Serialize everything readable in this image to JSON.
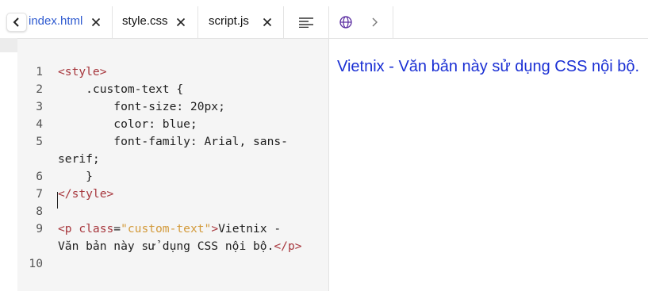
{
  "tabs": [
    {
      "label": "index.html",
      "active": true
    },
    {
      "label": "style.css"
    },
    {
      "label": "script.js"
    }
  ],
  "icons": {
    "back": "chevron-left-icon",
    "close": "close-icon",
    "format": "align-lines-icon",
    "preview_globe": "globe-icon",
    "preview_next": "chevron-right-icon"
  },
  "editor": {
    "line_numbers": [
      "1",
      "2",
      "3",
      "4",
      "5",
      "",
      "6",
      "7",
      "8",
      "9",
      "",
      "10"
    ],
    "lines": [
      {
        "tokens": [
          {
            "c": "tag",
            "t": "<style>"
          }
        ]
      },
      {
        "tokens": [
          {
            "c": "plain",
            "t": "    .custom-text {"
          }
        ]
      },
      {
        "tokens": [
          {
            "c": "plain",
            "t": "        font-size: 20px;"
          }
        ]
      },
      {
        "tokens": [
          {
            "c": "plain",
            "t": "        color: blue;"
          }
        ]
      },
      {
        "tokens": [
          {
            "c": "plain",
            "t": "        font-family: Arial, sans-"
          }
        ]
      },
      {
        "tokens": [
          {
            "c": "plain",
            "t": "serif;"
          }
        ]
      },
      {
        "tokens": [
          {
            "c": "plain",
            "t": "    }"
          }
        ]
      },
      {
        "tokens": [
          {
            "c": "tag",
            "t": "</style>"
          }
        ]
      },
      {
        "tokens": []
      },
      {
        "tokens": [
          {
            "c": "tag",
            "t": "<p "
          },
          {
            "c": "attr",
            "t": "class"
          },
          {
            "c": "plain",
            "t": "="
          },
          {
            "c": "str",
            "t": "\"custom-text\""
          },
          {
            "c": "tag",
            "t": ">"
          },
          {
            "c": "plain",
            "t": "Vietnix -"
          }
        ]
      },
      {
        "tokens": [
          {
            "c": "plain",
            "t": "Văn bản này sử dụng CSS nội bộ."
          },
          {
            "c": "tag",
            "t": "</p>"
          }
        ]
      },
      {
        "tokens": []
      }
    ]
  },
  "preview": {
    "text": "Vietnix - Văn bản này sử dụng CSS nội bộ.",
    "text_color": "#1a2fd4"
  },
  "colors": {
    "active_tab": "#2f5bd0",
    "tag": "#a7373d",
    "string": "#d39a3a"
  }
}
